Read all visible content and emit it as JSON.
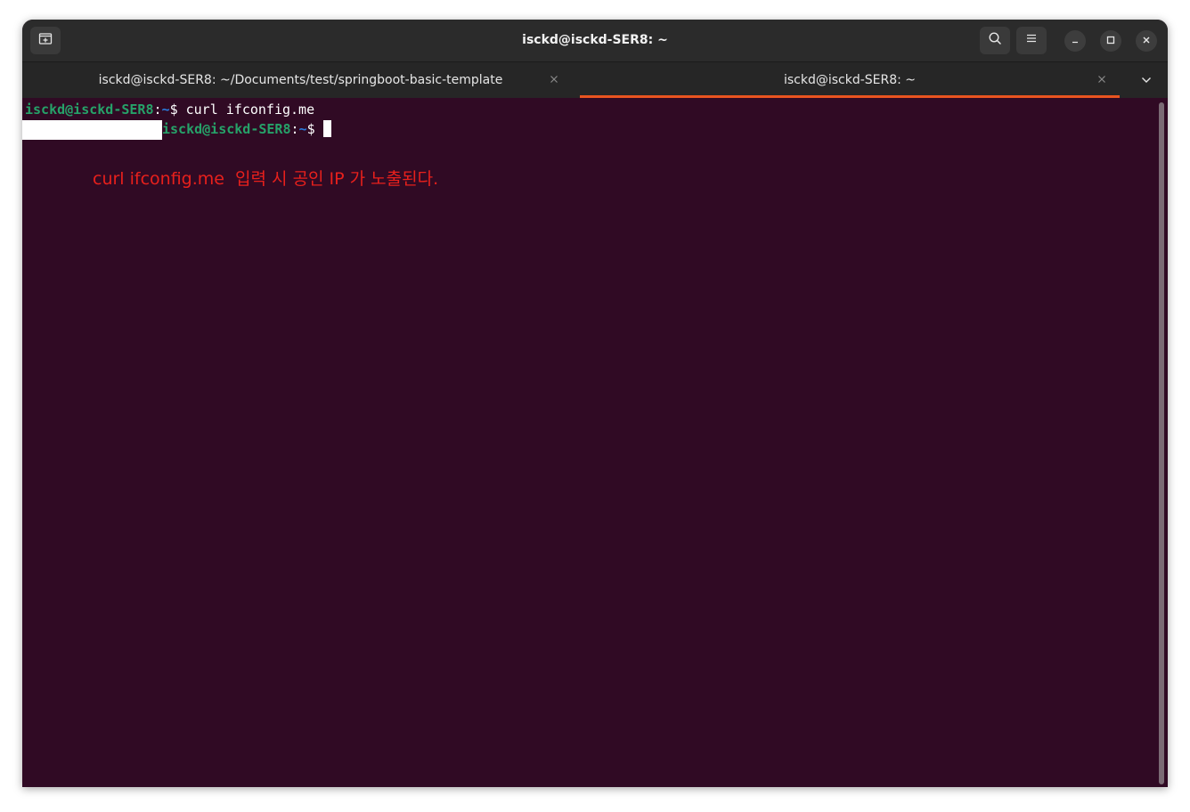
{
  "window": {
    "title": "isckd@isckd-SER8: ~"
  },
  "tabs": [
    {
      "label": "isckd@isckd-SER8: ~/Documents/test/springboot-basic-template",
      "active": false
    },
    {
      "label": "isckd@isckd-SER8: ~",
      "active": true
    }
  ],
  "terminal": {
    "lines": [
      {
        "user_host": "isckd@isckd-SER8",
        "colon": ":",
        "path": "~",
        "dollar": "$ ",
        "command": "curl ifconfig.me"
      },
      {
        "output_redacted": true,
        "user_host": "isckd@isckd-SER8",
        "colon": ":",
        "path": "~",
        "dollar": "$ ",
        "command": ""
      }
    ]
  },
  "annotation": {
    "text": "curl ifconfig.me  입력 시 공인 IP 가 노출된다."
  },
  "colors": {
    "terminal_bg": "#300a24",
    "prompt_user": "#26a269",
    "prompt_path": "#2a7bde",
    "active_tab_underline": "#e95420",
    "annotation_red": "#e8201c"
  },
  "icons": {
    "new_tab": "new-tab-icon",
    "search": "search-icon",
    "menu": "hamburger-menu-icon",
    "minimize": "minimize-icon",
    "maximize": "maximize-icon",
    "close": "close-icon",
    "tab_close": "tab-close-icon",
    "tab_overflow": "chevron-down-icon"
  }
}
